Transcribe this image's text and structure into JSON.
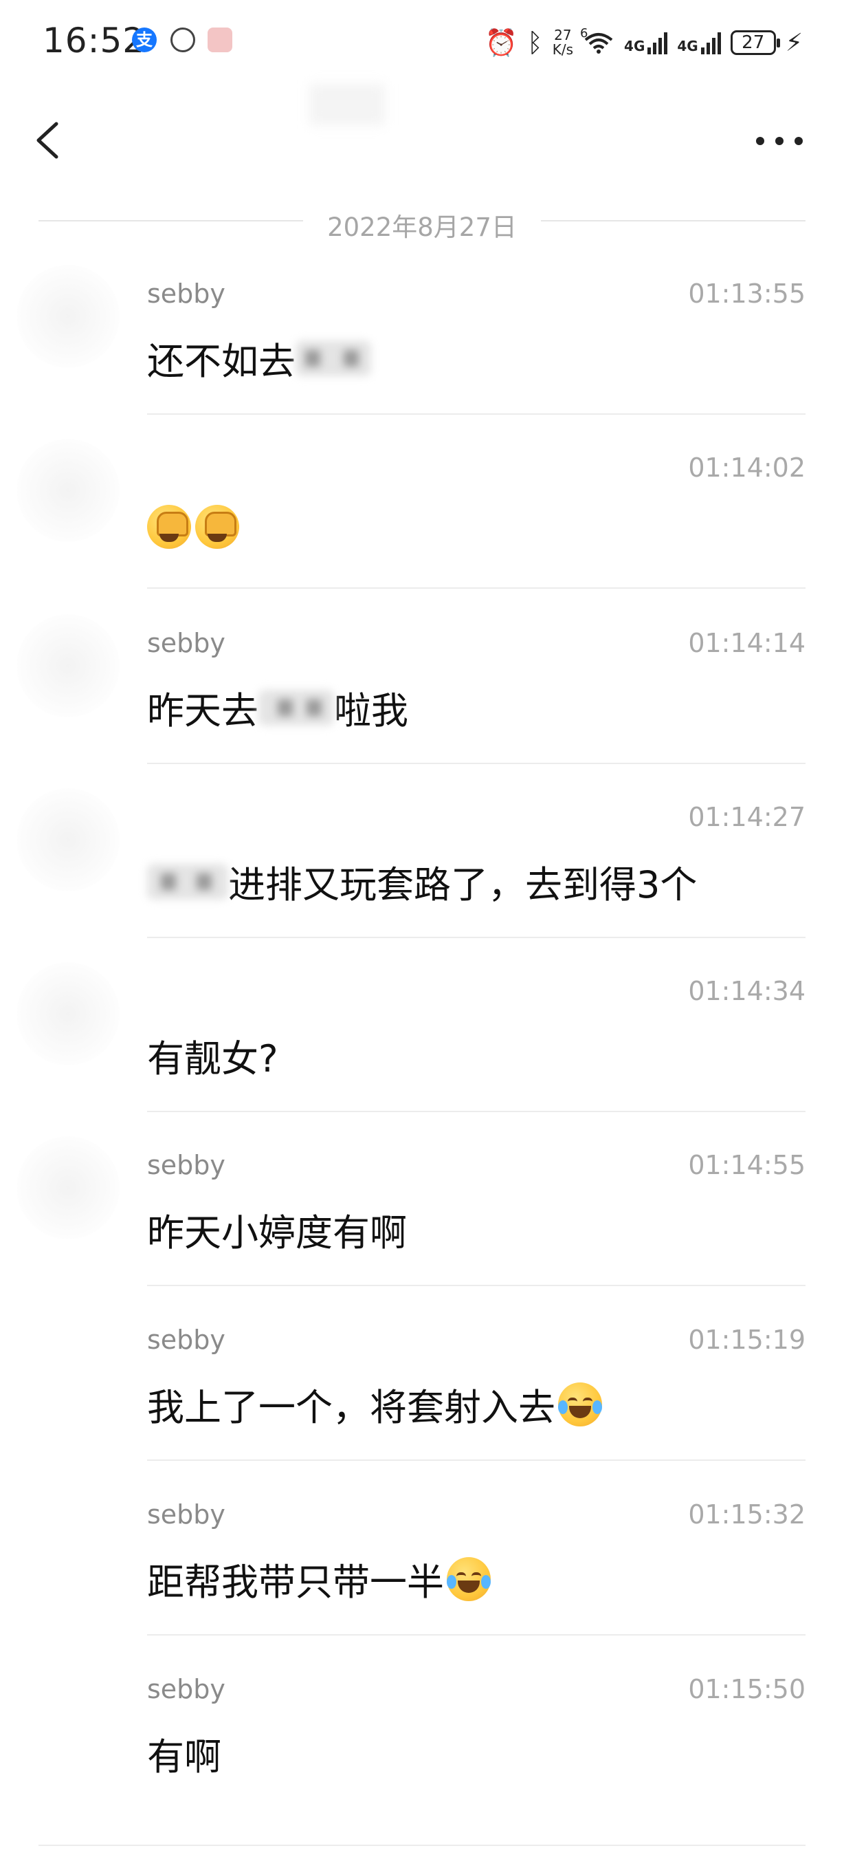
{
  "status_bar": {
    "time": "16:52",
    "network_speed_value": "27",
    "network_speed_unit": "K/s",
    "wifi_badge": "6",
    "sim1_label": "4G",
    "sim2_label": "4G",
    "battery_level": "27",
    "icons": [
      "alipay-icon",
      "app-icon",
      "app-icon",
      "alarm-icon",
      "bluetooth-icon",
      "wifi-icon",
      "signal-icon",
      "signal-icon",
      "battery-icon",
      "charging-icon"
    ]
  },
  "nav": {
    "back_icon": "chevron-left-icon",
    "more_icon": "more-dots-icon"
  },
  "date_divider": "2022年8月27日",
  "messages": [
    {
      "sender": "sebby",
      "time": "01:13:55",
      "text_before": "还不如去",
      "text_after": ""
    },
    {
      "sender": "",
      "time": "01:14:02",
      "text_before": "",
      "text_after": ""
    },
    {
      "sender": "sebby",
      "time": "01:14:14",
      "text_before": "昨天去",
      "text_after": "啦我"
    },
    {
      "sender": "",
      "time": "01:14:27",
      "text_before": "",
      "text_after": "进排又玩套路了，去到得3个"
    },
    {
      "sender": "",
      "time": "01:14:34",
      "text_before": "有靓女?",
      "text_after": ""
    },
    {
      "sender": "sebby",
      "time": "01:14:55",
      "text_before": "昨天小婷度有啊",
      "text_after": ""
    },
    {
      "sender": "sebby",
      "time": "01:15:19",
      "text_before": "我上了一个，将套射入去",
      "text_after": ""
    },
    {
      "sender": "sebby",
      "time": "01:15:32",
      "text_before": "距帮我带只带一半",
      "text_after": ""
    },
    {
      "sender": "sebby",
      "time": "01:15:50",
      "text_before": "有啊",
      "text_after": ""
    }
  ],
  "colors": {
    "background": "#ffffff",
    "text": "#111111",
    "sender": "#8a8a8a",
    "timestamp": "#a9a9a9",
    "divider": "#ececec"
  }
}
